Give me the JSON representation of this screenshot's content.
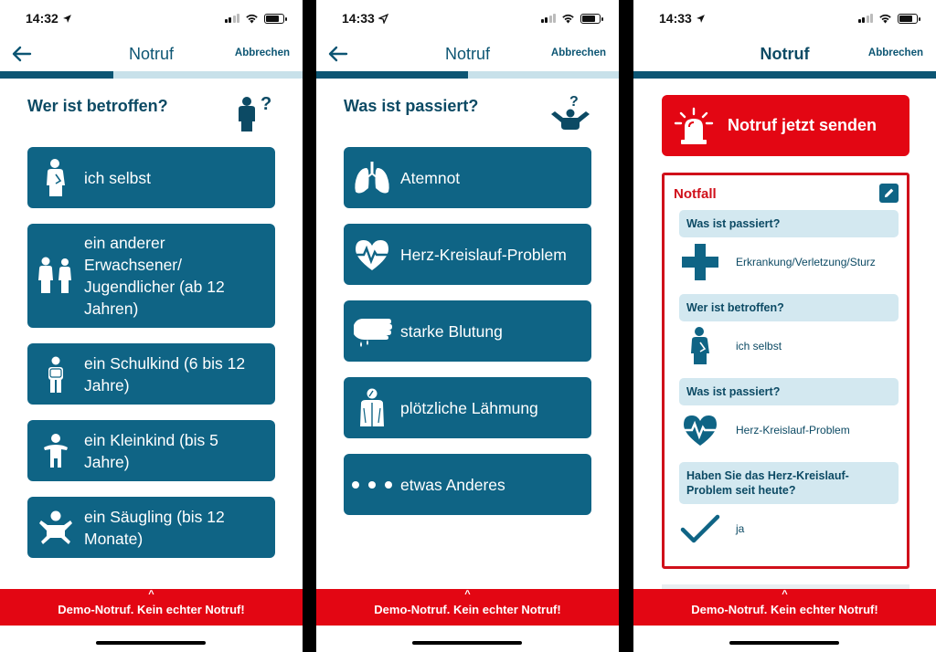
{
  "status": {
    "screen1_time": "14:32",
    "screen2_time": "14:33",
    "screen3_time": "14:33"
  },
  "nav": {
    "title": "Notruf",
    "cancel": "Abbrechen"
  },
  "screen1": {
    "progress": 0.5,
    "question": "Wer ist betroffen?",
    "options": [
      {
        "icon": "person-self-icon",
        "label": "ich selbst"
      },
      {
        "icon": "two-adults-icon",
        "label": "ein anderer Erwachsener/ Jugendlicher (ab 12 Jahren)"
      },
      {
        "icon": "schoolchild-icon",
        "label": "ein Schulkind (6 bis 12 Jahre)"
      },
      {
        "icon": "toddler-icon",
        "label": "ein Kleinkind (bis 5 Jahre)"
      },
      {
        "icon": "baby-icon",
        "label": "ein Säugling (bis 12 Monate)"
      }
    ]
  },
  "screen2": {
    "progress": 0.5,
    "question": "Was ist passiert?",
    "options": [
      {
        "icon": "lungs-icon",
        "label": "Atemnot"
      },
      {
        "icon": "heart-pulse-icon",
        "label": "Herz-Kreislauf-Problem"
      },
      {
        "icon": "bleeding-hand-icon",
        "label": "starke Blutung"
      },
      {
        "icon": "paralysis-icon",
        "label": "plötzliche Lähmung"
      },
      {
        "icon": "more-dots-icon",
        "label": "etwas Anderes"
      }
    ]
  },
  "screen3": {
    "progress": 1.0,
    "send_label": "Notruf jetzt senden",
    "summary_title": "Notfall",
    "items": [
      {
        "question": "Was ist passiert?",
        "answer": "Erkrankung/Verletzung/Sturz",
        "icon": "medical-cross-icon"
      },
      {
        "question": "Wer ist betroffen?",
        "answer": "ich selbst",
        "icon": "person-self-icon"
      },
      {
        "question": "Was ist passiert?",
        "answer": "Herz-Kreislauf-Problem",
        "icon": "heart-pulse-icon"
      },
      {
        "question": "Haben Sie das Herz-Kreislauf-Problem seit heute?",
        "answer": "ja",
        "icon": "checkmark-icon"
      }
    ]
  },
  "banner": {
    "chevron": "^",
    "text": "Demo-Notruf. Kein echter Notruf!"
  },
  "colors": {
    "primary": "#0f6485",
    "primary_dark": "#0c4a64",
    "progress_track": "#c8e1ea",
    "alert_red": "#e30613",
    "summary_question_bg": "#d3e8f0"
  }
}
